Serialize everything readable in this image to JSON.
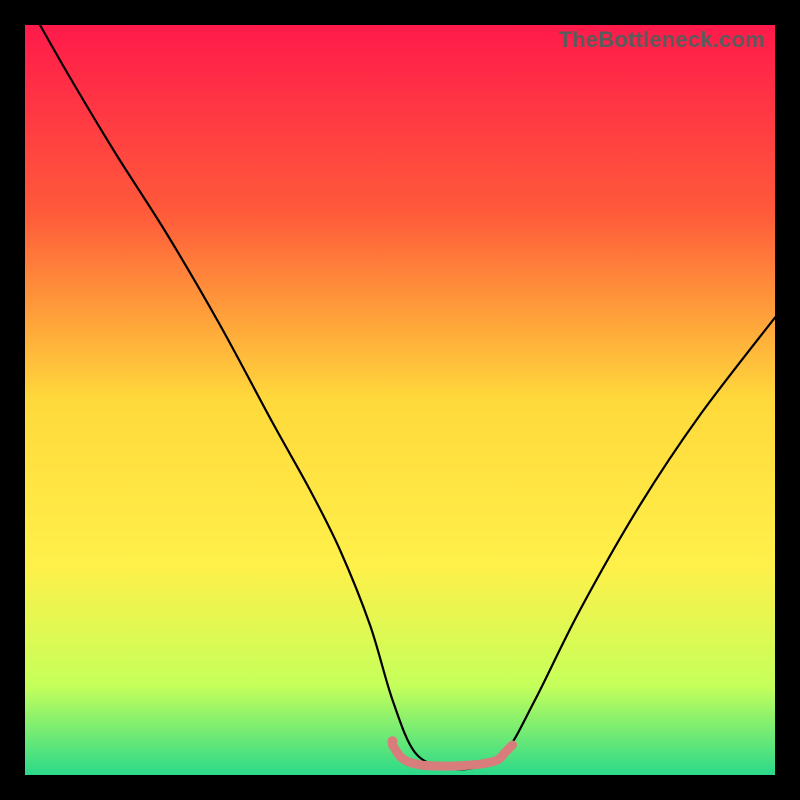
{
  "watermark": "TheBottleneck.com",
  "chart_data": {
    "type": "line",
    "title": "",
    "xlabel": "",
    "ylabel": "",
    "xlim": [
      0,
      100
    ],
    "ylim": [
      0,
      100
    ],
    "gradient_stops": [
      {
        "offset": 0,
        "color": "#ff1a4b"
      },
      {
        "offset": 25,
        "color": "#ff5a3a"
      },
      {
        "offset": 50,
        "color": "#ffd93b"
      },
      {
        "offset": 72,
        "color": "#fff04a"
      },
      {
        "offset": 88,
        "color": "#c6ff5a"
      },
      {
        "offset": 100,
        "color": "#2bd98a"
      }
    ],
    "series": [
      {
        "name": "bottleneck-curve",
        "stroke": "#000000",
        "x": [
          2,
          6,
          12,
          19,
          26,
          33,
          38,
          42,
          46,
          49,
          52,
          56,
          60,
          64,
          68,
          74,
          82,
          90,
          100
        ],
        "y": [
          100,
          93,
          83,
          72,
          60,
          47,
          38,
          30,
          20,
          10,
          3,
          1,
          1,
          3,
          10,
          22,
          36,
          48,
          61
        ]
      },
      {
        "name": "optimal-zone-marker",
        "stroke": "#d87c7c",
        "x": [
          49,
          50,
          51,
          52,
          53,
          55,
          57,
          59,
          61,
          63,
          64,
          65
        ],
        "y": [
          4,
          2.5,
          1.8,
          1.5,
          1.3,
          1.2,
          1.2,
          1.3,
          1.5,
          2,
          3,
          4
        ]
      }
    ],
    "marker_dot": {
      "x": 49,
      "y": 4.5,
      "r": 5,
      "fill": "#d87c7c"
    }
  }
}
